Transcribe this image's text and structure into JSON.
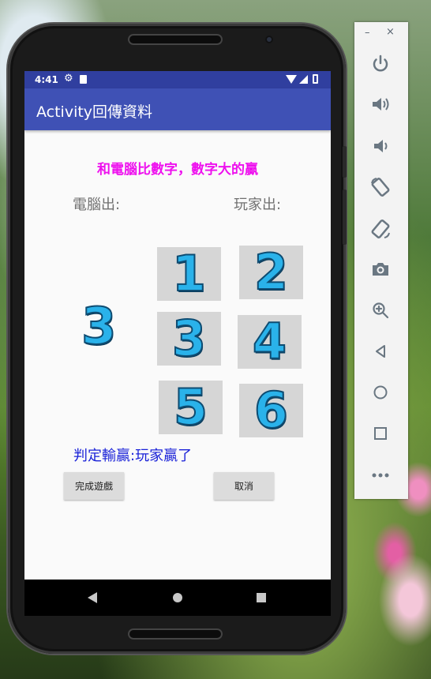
{
  "status_bar": {
    "time": "4:41"
  },
  "app_bar": {
    "title": "Activity回傳資料"
  },
  "content": {
    "headline": "和電腦比數字，數字大的贏",
    "cpu_label": "電腦出:",
    "player_label": "玩家出:",
    "cpu_choice": "3",
    "choices": [
      "1",
      "2",
      "3",
      "4",
      "5",
      "6"
    ],
    "result": "判定輸贏:玩家贏了",
    "finish_button": "完成遊戲",
    "cancel_button": "取消"
  },
  "emulator_toolbar": {
    "minimize": "–",
    "close": "×",
    "icons": [
      "power-icon",
      "volume-up-icon",
      "volume-down-icon",
      "rotate-left-icon",
      "rotate-right-icon",
      "camera-icon",
      "zoom-icon",
      "back-icon",
      "home-icon",
      "overview-icon",
      "more-icon"
    ]
  },
  "colors": {
    "status_bar": "#303f9f",
    "app_bar": "#3f51b5",
    "headline": "#ee10ee",
    "result": "#1a22d8",
    "digit_fill": "#2ab2ea"
  }
}
